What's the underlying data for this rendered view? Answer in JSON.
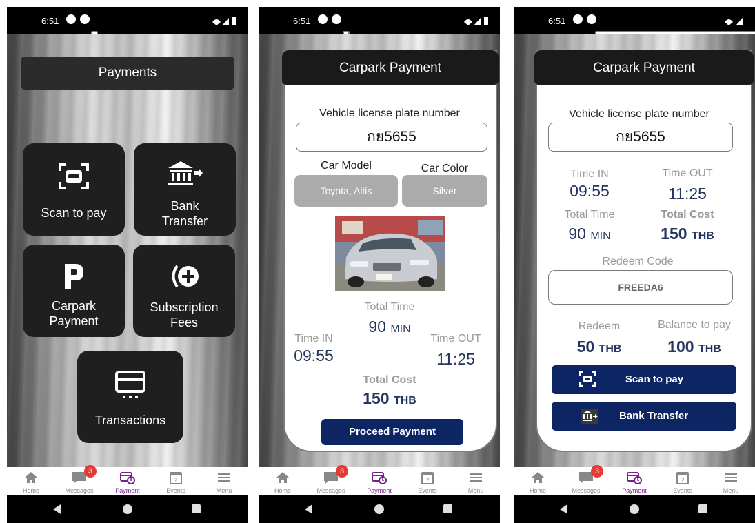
{
  "status": {
    "time": "6:51"
  },
  "bottom_nav": [
    {
      "label": "Home",
      "icon": "home-icon"
    },
    {
      "label": "Messages",
      "icon": "message-icon",
      "badge": "3"
    },
    {
      "label": "Payment",
      "icon": "payment-icon"
    },
    {
      "label": "Events",
      "icon": "calendar-icon"
    },
    {
      "label": "Menu",
      "icon": "menu-icon"
    }
  ],
  "screen1": {
    "title": "Payments",
    "tiles": {
      "scan": "Scan to pay",
      "bank_line1": "Bank",
      "bank_line2": "Transfer",
      "carpark_line1": "Carpark",
      "carpark_line2": "Payment",
      "subs_line1": "Subscription",
      "subs_line2": "Fees",
      "transactions": "Transactions"
    }
  },
  "screen2": {
    "title": "Carpark Payment",
    "plate_label": "Vehicle license plate number",
    "plate_value": "กย5655",
    "car_model_label": "Car Model",
    "car_model_value": "Toyota, Altis",
    "car_color_label": "Car Color",
    "car_color_value": "Silver",
    "total_time_label": "Total Time",
    "total_time_value": "90",
    "total_time_unit": "MIN",
    "time_in_label": "Time IN",
    "time_in_value": "09:55",
    "time_out_label": "Time OUT",
    "time_out_value": "11:25",
    "total_cost_label": "Total Cost",
    "total_cost_value": "150",
    "total_cost_unit": "THB",
    "proceed_label": "Proceed Payment"
  },
  "screen3": {
    "title": "Carpark Payment",
    "plate_label": "Vehicle license plate number",
    "plate_value": "กย5655",
    "time_in_label": "Time IN",
    "time_in_value": "09:55",
    "time_out_label": "Time OUT",
    "time_out_value": "11:25",
    "total_time_label": "Total Time",
    "total_time_value": "90",
    "total_time_unit": "MIN",
    "total_cost_label": "Total Cost",
    "total_cost_value": "150",
    "total_cost_unit": "THB",
    "redeem_code_label": "Redeem Code",
    "redeem_code_value": "FREEDA6",
    "redeem_label": "Redeem",
    "redeem_value": "50",
    "redeem_unit": "THB",
    "balance_label": "Balance to pay",
    "balance_value": "100",
    "balance_unit": "THB",
    "scan_label": "Scan to pay",
    "bank_label": "Bank Transfer"
  },
  "colors": {
    "navy": "#0e2563",
    "value_blue": "#24365f",
    "active_nav": "#7a1d8c",
    "badge": "#e53935",
    "tile": "#1f1f1f"
  }
}
